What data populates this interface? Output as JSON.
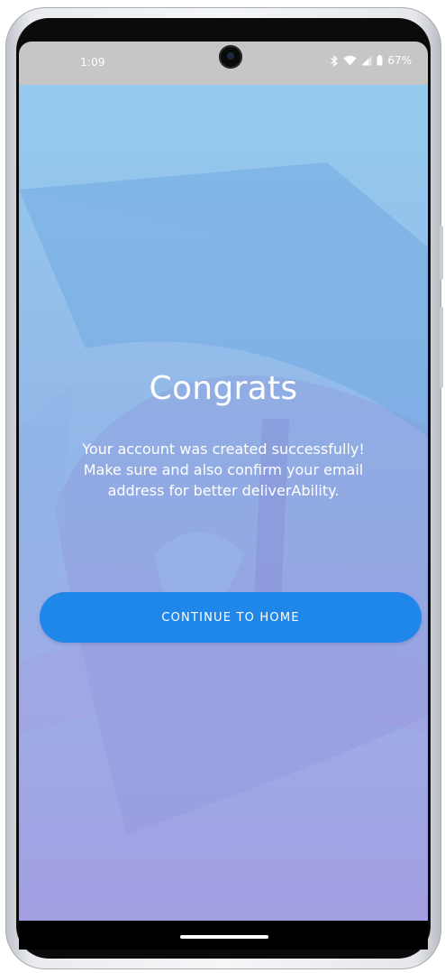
{
  "status_bar": {
    "time": "1:09",
    "battery_percent": "67%",
    "icons": [
      "bluetooth-icon",
      "wifi-icon",
      "signal-icon",
      "battery-icon"
    ]
  },
  "main": {
    "title": "Congrats",
    "message": "Your account was created successfully! Make sure and also confirm your email address for better deliverAbility.",
    "continue_label": "CONTINUE TO HOME"
  },
  "colors": {
    "button": "#1f86ea",
    "background_top": "#95cbee",
    "background_bottom": "#a39fe2"
  }
}
